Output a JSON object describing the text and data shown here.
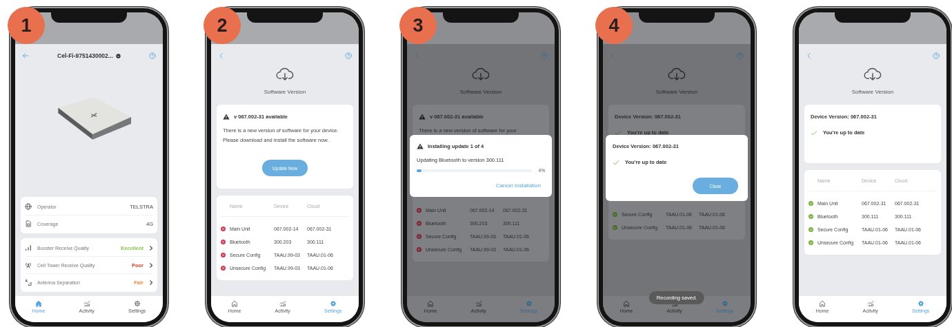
{
  "phones": [
    {
      "step": "1",
      "kind": "home",
      "dimmed": false,
      "title": "Cel-Fi-9751430002...",
      "info_rows": [
        {
          "label": "Operator",
          "value": "TELSTRA"
        },
        {
          "label": "Coverage",
          "value": "4G"
        }
      ],
      "quality_rows": [
        {
          "label": "Booster Receive Quality",
          "value": "Excellent",
          "color": "#8bc34a"
        },
        {
          "label": "Cell Tower Receive Quality",
          "value": "Poor",
          "color": "#d8452b"
        },
        {
          "label": "Antenna Separation",
          "value": "Fair",
          "color": "#ef8a3a"
        }
      ],
      "nav": [
        {
          "label": "Home",
          "selected": true
        },
        {
          "label": "Activity",
          "selected": false
        },
        {
          "label": "Settings",
          "selected": false
        }
      ]
    },
    {
      "step": "2",
      "kind": "software",
      "dimmed": false,
      "page_title": "Software Version",
      "status": {
        "kind": "update",
        "title": "v 067.002-31 available",
        "body": "There is a new version of software for your device. Please download and install the software now.",
        "button": "Update Now"
      },
      "table": {
        "columns": [
          "Name",
          "Device",
          "Cloud"
        ],
        "rows": [
          {
            "ok": false,
            "name": "Main Unit",
            "device": "067.002-14",
            "cloud": "067.002-31"
          },
          {
            "ok": false,
            "name": "Bluetooth",
            "device": "300.203",
            "cloud": "300.111"
          },
          {
            "ok": false,
            "name": "Secure Config",
            "device": "TAAU.99-03",
            "cloud": "TAAU.01-06"
          },
          {
            "ok": false,
            "name": "Unsecure Config",
            "device": "TAAU.99-03",
            "cloud": "TAAU.01-06"
          }
        ]
      },
      "nav": [
        {
          "label": "Home",
          "selected": false
        },
        {
          "label": "Activity",
          "selected": false
        },
        {
          "label": "Settings",
          "selected": true
        }
      ]
    },
    {
      "step": "3",
      "kind": "software",
      "dimmed": true,
      "page_title": "Software Version",
      "status": {
        "kind": "update",
        "title": "v 067.002-31 available",
        "body": "There is a new version of software for your"
      },
      "dialog": {
        "kind": "progress",
        "title": "Installing update 1 of 4",
        "message": "Updating Bluetooth to version 300.111",
        "level": 0.04,
        "reading": "4%",
        "action": "Cancel Installation"
      },
      "table": {
        "rows": [
          {
            "ok": false,
            "name": "Main Unit",
            "device": "067.002-14",
            "cloud": "067.002-31"
          },
          {
            "ok": false,
            "name": "Bluetooth",
            "device": "300.203",
            "cloud": "300.111"
          },
          {
            "ok": false,
            "name": "Secure Config",
            "device": "TAAU.99-03",
            "cloud": "TAAU.01-06"
          },
          {
            "ok": false,
            "name": "Unsecure Config",
            "device": "TAAU.99-03",
            "cloud": "TAAU.01-06"
          }
        ]
      },
      "nav": [
        {
          "label": "Home",
          "selected": false
        },
        {
          "label": "Activity",
          "selected": false
        },
        {
          "label": "Settings",
          "selected": true
        }
      ]
    },
    {
      "step": "4",
      "kind": "software",
      "dimmed": true,
      "page_title": "Software Version",
      "status": {
        "kind": "uptodate",
        "title": "Device Version: 067.002-31",
        "message": "You're up to date"
      },
      "dialog": {
        "kind": "done",
        "title": "Device Version: 067.002-31",
        "message": "You're up to date",
        "button": "Close"
      },
      "table": {
        "rows": [
          {
            "ok": true,
            "name": "Secure Config",
            "device": "TAAU.01-06",
            "cloud": "TAAU.01-06"
          },
          {
            "ok": true,
            "name": "Unsecure Config",
            "device": "TAAU.01-06",
            "cloud": "TAAU.01-06"
          }
        ]
      },
      "toast": "Recording saved.",
      "nav": [
        {
          "label": "Home",
          "selected": false
        },
        {
          "label": "Activity",
          "selected": false
        },
        {
          "label": "Settings",
          "selected": true
        }
      ]
    },
    {
      "kind": "software",
      "dimmed": false,
      "page_title": "Software Version",
      "status": {
        "kind": "uptodate",
        "title": "Device Version: 067.002-31",
        "message": "You're up to date"
      },
      "table": {
        "columns": [
          "Name",
          "Device",
          "Cloud"
        ],
        "rows": [
          {
            "ok": true,
            "name": "Main Unit",
            "device": "067.002-31",
            "cloud": "067.002-31"
          },
          {
            "ok": true,
            "name": "Bluetooth",
            "device": "300.111",
            "cloud": "300.111"
          },
          {
            "ok": true,
            "name": "Secure Config",
            "device": "TAAU.01-06",
            "cloud": "TAAU.01-06"
          },
          {
            "ok": true,
            "name": "Unsecure Config",
            "device": "TAAU.01-06",
            "cloud": "TAAU.01-06"
          }
        ]
      },
      "nav": [
        {
          "label": "Home",
          "selected": false
        },
        {
          "label": "Activity",
          "selected": false
        },
        {
          "label": "Settings",
          "selected": true
        }
      ]
    }
  ]
}
